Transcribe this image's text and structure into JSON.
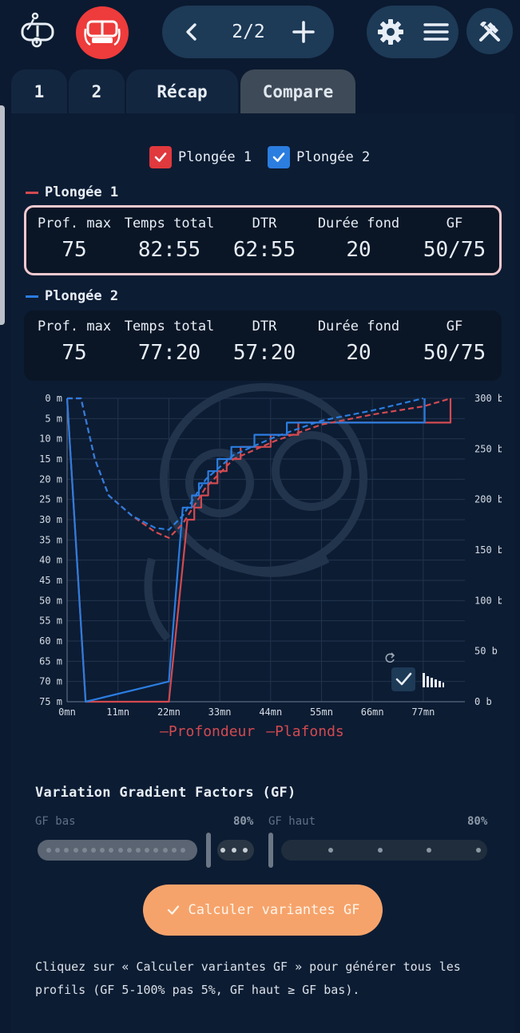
{
  "header": {
    "page_indicator": "2/2",
    "icons": [
      "diver-logo-icon",
      "mask-icon",
      "chevron-left-icon",
      "plus-icon",
      "gear-icon",
      "hamburger-menu-icon",
      "tools-icon"
    ]
  },
  "tabs": [
    {
      "label": "1",
      "active": false
    },
    {
      "label": "2",
      "active": false
    },
    {
      "label": "Récap",
      "active": false
    },
    {
      "label": "Compare",
      "active": true
    }
  ],
  "toggles": [
    {
      "label": "Plongée 1",
      "checked": true,
      "color": "#e0393e"
    },
    {
      "label": "Plongée 2",
      "checked": true,
      "color": "#2b7de0"
    }
  ],
  "dives": [
    {
      "title": "Plongée 1",
      "color": "#d24a50",
      "stats": [
        {
          "label": "Prof. max",
          "value": "75"
        },
        {
          "label": "Temps total",
          "value": "82:55"
        },
        {
          "label": "DTR",
          "value": "62:55"
        },
        {
          "label": "Durée fond",
          "value": "20"
        },
        {
          "label": "GF",
          "value": "50/75"
        }
      ]
    },
    {
      "title": "Plongée 2",
      "color": "#2b7de0",
      "stats": [
        {
          "label": "Prof. max",
          "value": "75"
        },
        {
          "label": "Temps total",
          "value": "77:20"
        },
        {
          "label": "DTR",
          "value": "57:20"
        },
        {
          "label": "Durée fond",
          "value": "20"
        },
        {
          "label": "GF",
          "value": "50/75"
        }
      ]
    }
  ],
  "chart_data": {
    "type": "line",
    "x_ticks": [
      "0mn",
      "11mn",
      "22mn",
      "33mn",
      "44mn",
      "55mn",
      "66mn",
      "77mn"
    ],
    "x_tick_values": [
      0,
      11,
      22,
      33,
      44,
      55,
      66,
      77
    ],
    "y_ticks": [
      "0 m",
      "5 m",
      "10 m",
      "15 m",
      "20 m",
      "25 m",
      "30 m",
      "35 m",
      "40 m",
      "45 m",
      "50 m",
      "55 m",
      "60 m",
      "65 m",
      "70 m",
      "75 m"
    ],
    "y_tick_values": [
      0,
      5,
      10,
      15,
      20,
      25,
      30,
      35,
      40,
      45,
      50,
      55,
      60,
      65,
      70,
      75
    ],
    "y2_ticks": [
      "300 b",
      "250 b",
      "200 b",
      "150 b",
      "100 b",
      "50 b",
      "0 b"
    ],
    "xlim": [
      0,
      86
    ],
    "ylim": [
      75,
      0
    ],
    "grid": true,
    "legend": [
      "Profondeur",
      "Plafonds"
    ],
    "series": [
      {
        "name": "Profondeur",
        "dive": "Plongée 1",
        "color": "#d24a50",
        "style": "solid",
        "points": [
          [
            0,
            0
          ],
          [
            4,
            75
          ],
          [
            22,
            75
          ],
          [
            26,
            30
          ],
          [
            27.5,
            30
          ],
          [
            27.5,
            27
          ],
          [
            29,
            27
          ],
          [
            29,
            24
          ],
          [
            30.5,
            24
          ],
          [
            30.5,
            21
          ],
          [
            32.5,
            21
          ],
          [
            32.5,
            18
          ],
          [
            34.5,
            18
          ],
          [
            34.5,
            15
          ],
          [
            37.5,
            15
          ],
          [
            37.5,
            12
          ],
          [
            44,
            12
          ],
          [
            44,
            9
          ],
          [
            50,
            9
          ],
          [
            50,
            6
          ],
          [
            82.9,
            6
          ],
          [
            82.9,
            0
          ]
        ]
      },
      {
        "name": "Profondeur",
        "dive": "Plongée 2",
        "color": "#2b7de0",
        "style": "solid",
        "points": [
          [
            0,
            0
          ],
          [
            4,
            75
          ],
          [
            22,
            70
          ],
          [
            25,
            27
          ],
          [
            27,
            27
          ],
          [
            27,
            24
          ],
          [
            28.5,
            24
          ],
          [
            28.5,
            21
          ],
          [
            30.5,
            21
          ],
          [
            30.5,
            18
          ],
          [
            32.5,
            18
          ],
          [
            32.5,
            15
          ],
          [
            35.5,
            15
          ],
          [
            35.5,
            12
          ],
          [
            40.5,
            12
          ],
          [
            40.5,
            9
          ],
          [
            47.5,
            9
          ],
          [
            47.5,
            6
          ],
          [
            77.3,
            6
          ],
          [
            77.3,
            0
          ]
        ]
      },
      {
        "name": "Plafonds",
        "dive": "Plongée 1",
        "color": "#d24a50",
        "style": "dashed",
        "points": [
          [
            0,
            0
          ],
          [
            3,
            0
          ],
          [
            6,
            15
          ],
          [
            9,
            24
          ],
          [
            14,
            29
          ],
          [
            19,
            33
          ],
          [
            22,
            34.5
          ],
          [
            25,
            31
          ],
          [
            30,
            22
          ],
          [
            36,
            15
          ],
          [
            45,
            10.5
          ],
          [
            55,
            6.5
          ],
          [
            66,
            4
          ],
          [
            77,
            2
          ],
          [
            83,
            0
          ]
        ]
      },
      {
        "name": "Plafonds",
        "dive": "Plongée 2",
        "color": "#2b7de0",
        "style": "dashed",
        "points": [
          [
            0,
            0
          ],
          [
            3,
            0
          ],
          [
            6,
            15
          ],
          [
            9,
            24
          ],
          [
            14,
            29
          ],
          [
            19,
            32
          ],
          [
            22,
            32.5
          ],
          [
            25,
            29
          ],
          [
            30,
            20
          ],
          [
            36,
            14
          ],
          [
            45,
            9.5
          ],
          [
            55,
            5.5
          ],
          [
            66,
            3
          ],
          [
            77,
            0
          ]
        ]
      }
    ]
  },
  "chart_controls": {
    "icons": [
      "reset-icon",
      "checkmark-toggle-icon",
      "bar-chart-icon"
    ]
  },
  "gf": {
    "title": "Variation Gradient Factors (GF)",
    "low_label": "GF bas",
    "low_value": "80%",
    "low_level": 0.8,
    "high_label": "GF haut",
    "high_value": "80%",
    "high_level": 0.0
  },
  "calc_button": {
    "label": "Calculer variantes GF"
  },
  "help_text": "Cliquez sur « Calculer variantes GF » pour générer tous les profils (GF 5-100% pas 5%, GF haut ≥ GF bas)."
}
